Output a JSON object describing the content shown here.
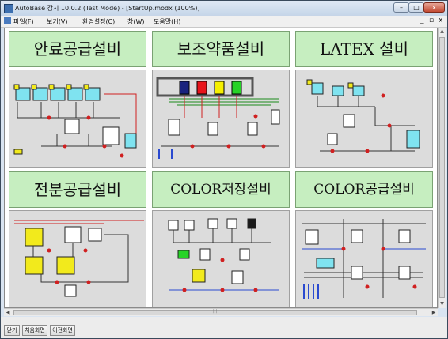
{
  "window": {
    "title": "AutoBase 감시 10.0.2 (Test Mode) - [StartUp.modx (100%)]",
    "controls": {
      "minimize": "–",
      "maximize": "□",
      "close": "x"
    }
  },
  "menu": {
    "items": [
      "파일(F)",
      "보기(V)",
      "환경설정(C)",
      "창(W)",
      "도움말(H)"
    ],
    "mdi_controls": [
      "_",
      "▫",
      "x"
    ]
  },
  "panels": [
    {
      "title": "안료공급설비"
    },
    {
      "title": "보조약품설비"
    },
    {
      "title": "LATEX 설비"
    },
    {
      "title": "전분공급설비"
    },
    {
      "title": "COLOR저장설비"
    },
    {
      "title": "COLOR공급설비"
    }
  ],
  "bottom_buttons": [
    "닫기",
    "처음화면",
    "이전화면"
  ],
  "colors": {
    "banner_bg": "#c6eec0",
    "diagram_bg": "#dcdcdc",
    "tank_cyan": "#7fe3f0",
    "tank_yellow": "#f2ea1c",
    "pipe_red": "#d02020",
    "tank_navy": "#1a237e",
    "tank_red": "#e8141b",
    "tank_yellow2": "#f5ef00",
    "tank_green": "#27d327"
  }
}
